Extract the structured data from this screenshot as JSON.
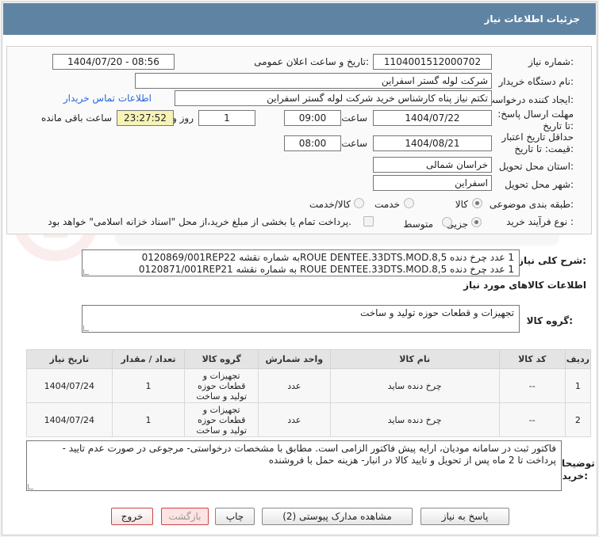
{
  "header": {
    "title": "جزئیات اطلاعات نیاز"
  },
  "fields": {
    "need_number_label": "شماره نیاز:",
    "need_number": "1104001512000702",
    "announce_label": "تاریخ و ساعت اعلان عمومی:",
    "announce_value": "1404/07/20 - 08:56",
    "buyer_org_label": "نام دستگاه خریدار:",
    "buyer_org": "شرکت لوله گستر اسفراین",
    "requester_label": "ایجاد کننده درخواست:",
    "requester": "تکتم نیاز پناه کارشناس خرید شرکت لوله گستر اسفراین",
    "contact_link": "اطلاعات تماس خریدار",
    "deadline_label": "مهلت ارسال پاسخ: تا تاریخ:",
    "deadline_date": "1404/07/22",
    "time_label": "ساعت",
    "deadline_time": "09:00",
    "days_value": "1",
    "days_label": "روز و",
    "remaining_time": "23:27:52",
    "remaining_label": "ساعت باقی مانده",
    "min_validity_label": "حداقل تاریخ اعتبار قیمت: تا تاریخ:",
    "validity_date": "1404/08/21",
    "validity_time_label": "ساعت",
    "validity_time": "08:00",
    "province_label": "استان محل تحویل:",
    "province": "خراسان شمالی",
    "city_label": "شهر محل تحویل:",
    "city": "اسفراین",
    "category_label": "طبقه بندی موضوعی:",
    "category_options": [
      "کالا",
      "خدمت",
      "کالا/خدمت"
    ],
    "purchase_type_label": "نوع فرآیند خرید :",
    "purchase_options": [
      "جزیی",
      "متوسط"
    ],
    "treasury_note": "پرداخت تمام یا بخشی از مبلغ خرید،از محل \"اسناد خزانه اسلامی\" خواهد بود."
  },
  "summary": {
    "label": "شرح کلی نیاز:",
    "line1": "1 عدد      چرخ دنده ROUE DENTEE.33DTS.MOD.8,5به شماره نقشه 0120869/001REP22",
    "line2": "1 عدد چرخ دنده ROUE DENTEE.33DTS.MOD.8,5 به شماره نقشه 0120871/001REP21"
  },
  "goods_info_title": "اطلاعات کالاهای مورد نیاز",
  "goods_group": {
    "label": "گروه کالا:",
    "value": "تجهیزات و قطعات حوزه تولید و ساخت"
  },
  "table": {
    "headers": [
      "ردیف",
      "کد کالا",
      "نام کالا",
      "واحد شمارش",
      "گروه کالا",
      "تعداد / مقدار",
      "تاریخ نیاز"
    ],
    "rows": [
      {
        "row": "1",
        "code": "--",
        "name": "چرخ دنده ساید",
        "unit": "عدد",
        "group": "تجهیزات و قطعات حوزه تولید و ساخت",
        "qty": "1",
        "date": "1404/07/24"
      },
      {
        "row": "2",
        "code": "--",
        "name": "چرخ دنده ساید",
        "unit": "عدد",
        "group": "تجهیزات و قطعات حوزه تولید و ساخت",
        "qty": "1",
        "date": "1404/07/24"
      }
    ]
  },
  "notes": {
    "label": "توضیحات خریدار:",
    "line1": "فاکتور ثبت در سامانه مودیان، ارایه پیش فاکتور الزامی است. مطابق با مشخصات درخواستی- مرجوعی در صورت عدم تایید -",
    "line2": "پرداخت تا 2 ماه پس از تحویل و تایید کالا در انبار- هزینه حمل با فروشنده"
  },
  "buttons": {
    "respond": "پاسخ به نیاز",
    "attachments": "مشاهده مدارک پیوستی (2)",
    "print": "چاپ",
    "back": "بازگشت",
    "exit": "خروج"
  },
  "colors": {
    "header_bg": "#5f83a2",
    "link": "#2b66d9",
    "timer_bg": "#f7f3b6",
    "exit_border": "#cc4444"
  }
}
